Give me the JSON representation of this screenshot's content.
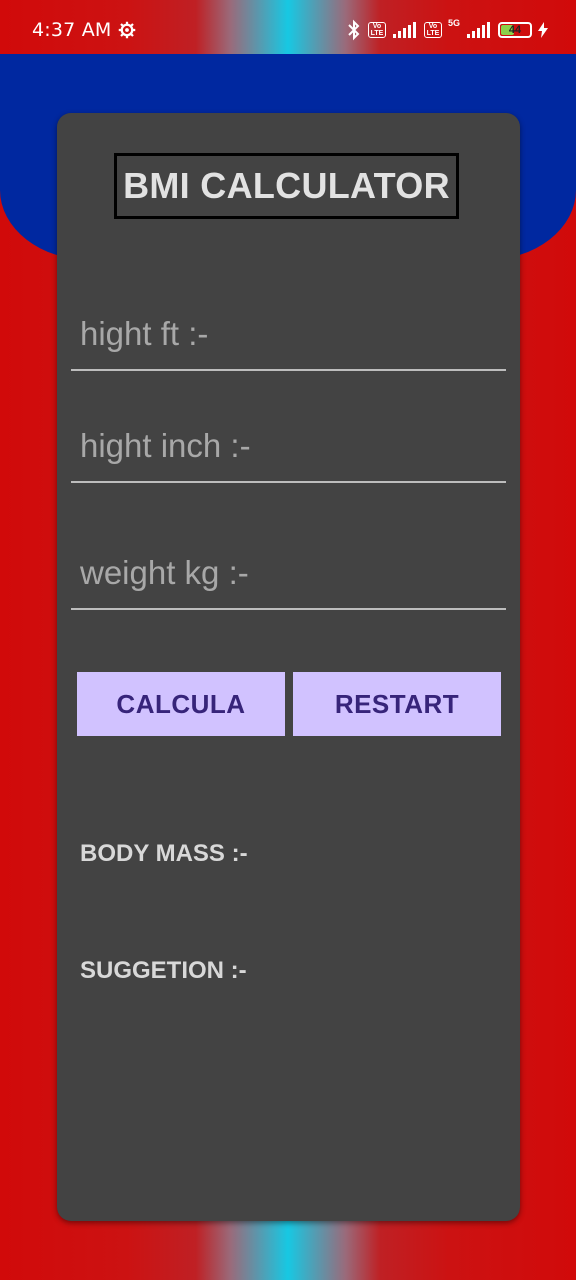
{
  "status_bar": {
    "time": "4:37 AM",
    "icons": [
      "gear-icon",
      "bluetooth-icon",
      "volte-icon",
      "signal-icon",
      "volte-icon",
      "5g-signal-icon",
      "battery-icon",
      "charging-icon"
    ],
    "volte_label": "Vo LTE",
    "network": "5G",
    "battery": "44"
  },
  "colors": {
    "background_edge": "#d10a0a",
    "background_center": "#17c8e3",
    "header_band": "#0028a0",
    "card": "#434343",
    "button_bg": "#d1c2ff",
    "button_text": "#37247a"
  },
  "app": {
    "title": "BMI CALCULATOR",
    "fields": {
      "height_ft": {
        "placeholder": "hight ft :-",
        "value": ""
      },
      "height_inch": {
        "placeholder": "hight inch :-",
        "value": ""
      },
      "weight_kg": {
        "placeholder": "weight kg :-",
        "value": ""
      }
    },
    "buttons": {
      "calculate": "CALCULA",
      "restart": "RESTART"
    },
    "results": {
      "body_mass_label": "BODY MASS :-",
      "suggestion_label": "SUGGETION :-"
    }
  }
}
